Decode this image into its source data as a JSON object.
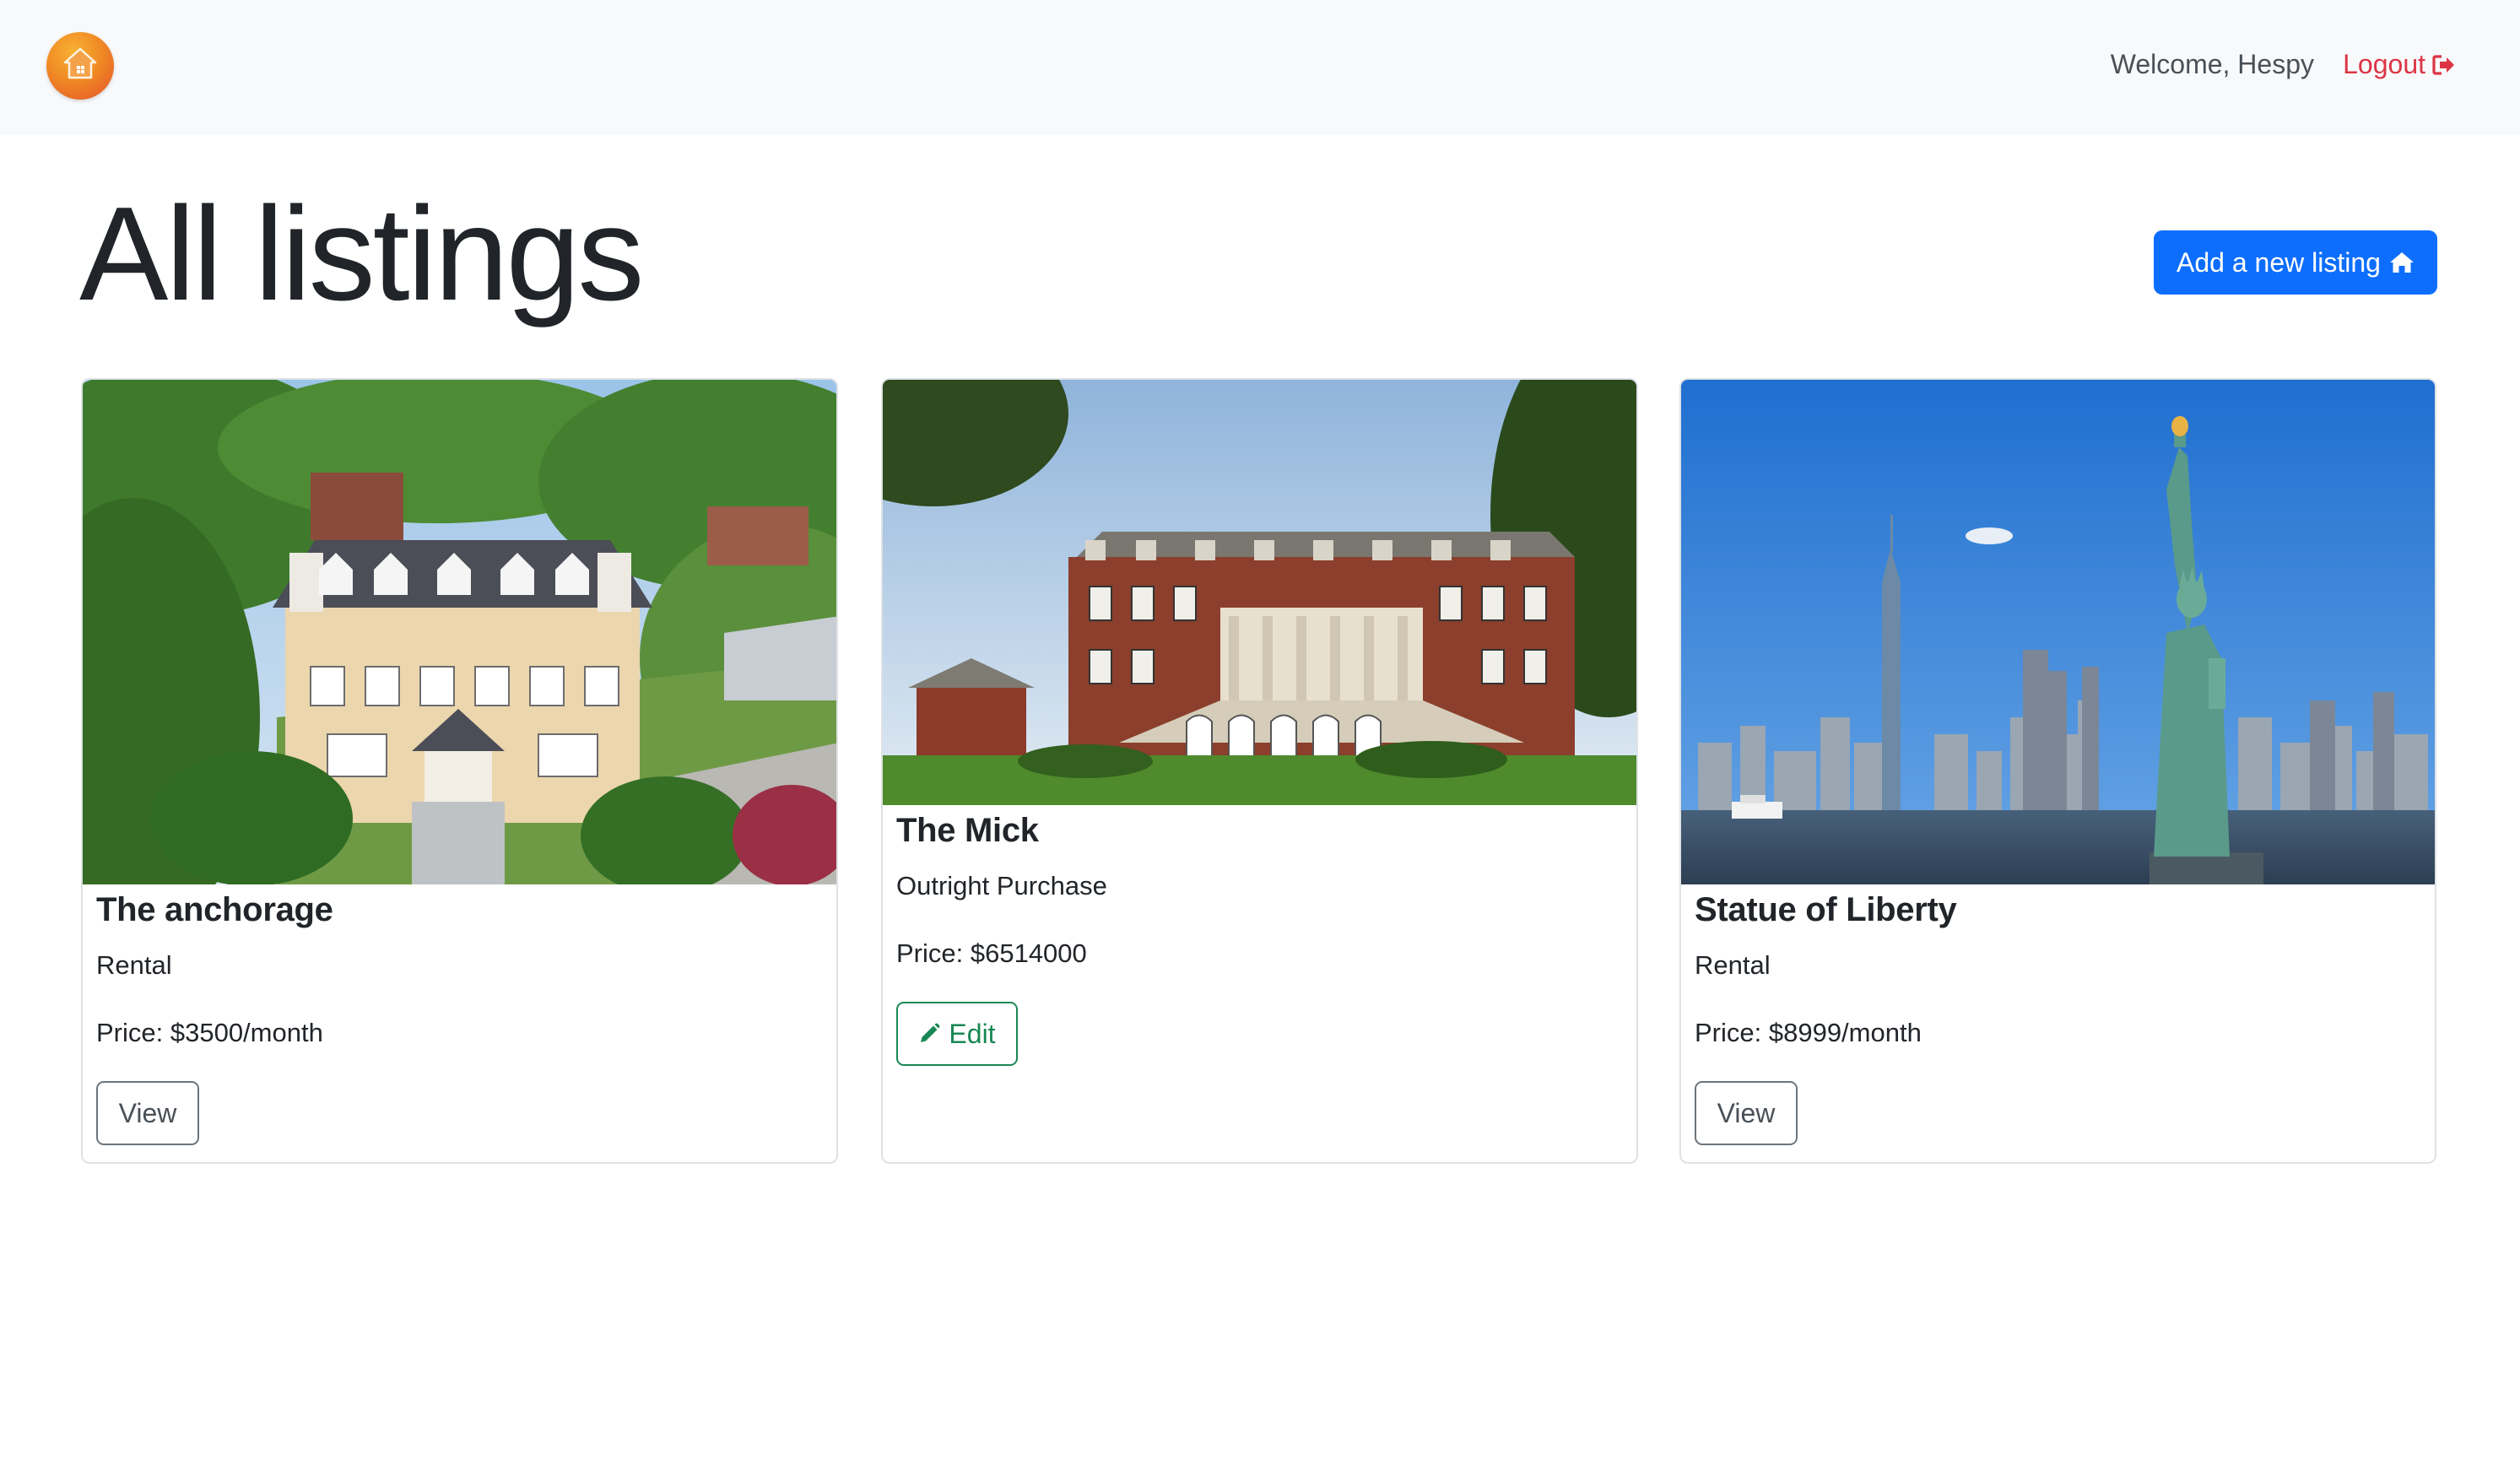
{
  "navbar": {
    "welcome_text": "Welcome, Hespy",
    "logout_label": "Logout"
  },
  "header": {
    "title": "All listings",
    "add_button_label": "Add a new listing"
  },
  "listings": [
    {
      "title": "The anchorage",
      "type": "Rental",
      "price": "Price: $3500/month",
      "action_label": "View",
      "image": "suburban-house-photo"
    },
    {
      "title": "The Mick",
      "type": "Outright Purchase",
      "price": "Price: $6514000",
      "action_label": "Edit",
      "image": "brick-mansion-photo"
    },
    {
      "title": "Statue of Liberty",
      "type": "Rental",
      "price": "Price: $8999/month",
      "action_label": "View",
      "image": "statue-of-liberty-skyline-photo"
    }
  ],
  "colors": {
    "primary": "#0d6efd",
    "danger": "#dc3545",
    "success": "#198754",
    "navbar_bg": "#f8f9fa"
  }
}
